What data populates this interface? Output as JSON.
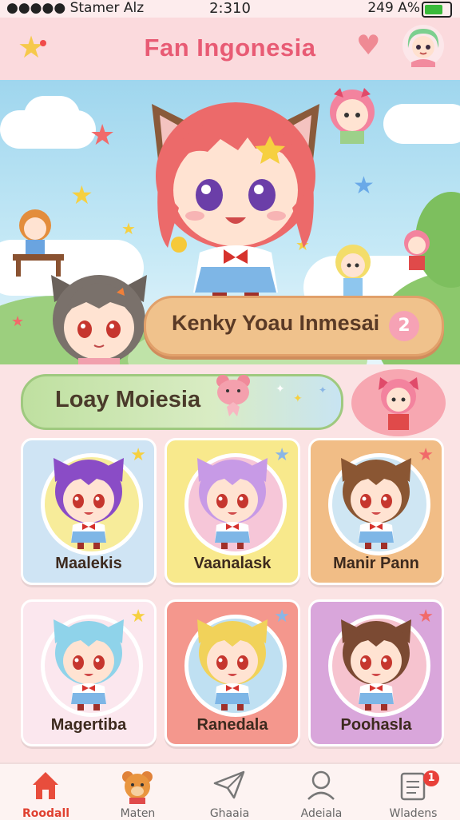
{
  "status_bar": {
    "carrier": "●●●●● Stamer Alz",
    "time": "2:310",
    "battery": "249 A%"
  },
  "header": {
    "title": "Fan Ingonesia",
    "accent": "#e85b74"
  },
  "hero": {
    "banner_text": "Kenky Yoau Inmesai",
    "badge": "2"
  },
  "sub_banner": {
    "text": "Loay Moiesia"
  },
  "characters": [
    {
      "name": "Maalekis",
      "bg": "#cfe4f4",
      "ring": "#f7ec9a",
      "hair": "#8a4cc6"
    },
    {
      "name": "Vaanalask",
      "bg": "#f8e98c",
      "ring": "#f6c6d8",
      "hair": "#c79ae6"
    },
    {
      "name": "Manir Pann",
      "bg": "#f1bd86",
      "ring": "#cfe6f3",
      "hair": "#8a5633"
    },
    {
      "name": "Magertiba",
      "bg": "#fbe7ee",
      "ring": "#fbe7ee",
      "hair": "#8fd3ea"
    },
    {
      "name": "Ranedala",
      "bg": "#f4978d",
      "ring": "#bfe0f2",
      "hair": "#f1d25a"
    },
    {
      "name": "Poohasla",
      "bg": "#d9a6db",
      "ring": "#f6c3cf",
      "hair": "#7b4a33"
    }
  ],
  "nav": {
    "items": [
      {
        "label": "Roodall",
        "icon": "home-icon",
        "active": true
      },
      {
        "label": "Maten",
        "icon": "bear-icon"
      },
      {
        "label": "Ghaaia",
        "icon": "paper-plane-icon"
      },
      {
        "label": "Adeiala",
        "icon": "profile-icon"
      },
      {
        "label": "Wladens",
        "icon": "notes-icon",
        "badge": "1"
      }
    ]
  }
}
